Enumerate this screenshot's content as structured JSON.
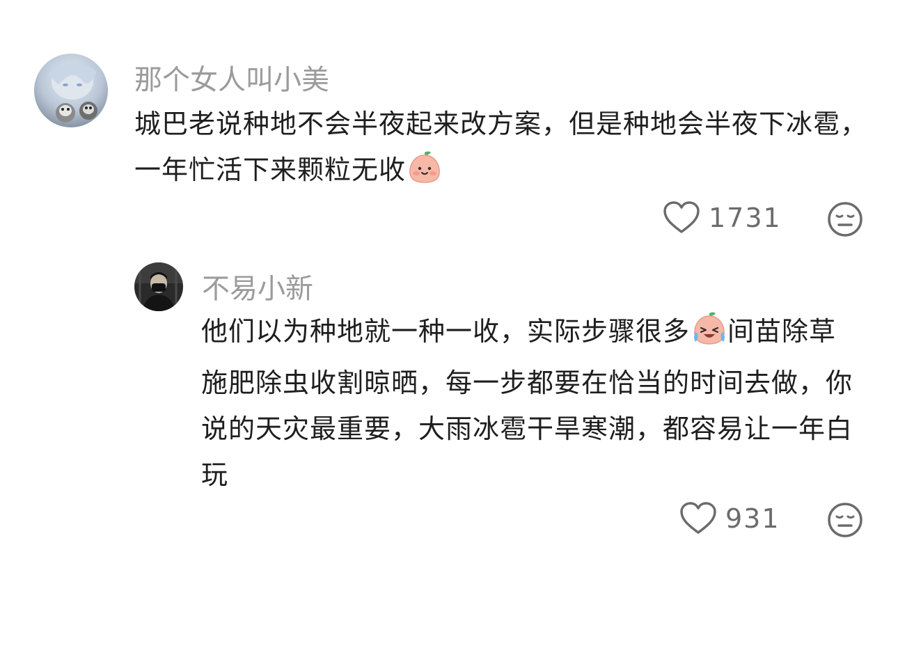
{
  "comments": [
    {
      "username": "那个女人叫小美",
      "text": "城巴老说种地不会半夜起来改方案，但是种地会半夜下冰雹，一年忙活下来颗粒无收",
      "emoji": "peach-smile-emoji",
      "likes": "1731",
      "avatar": "anime-girl-with-cats-avatar"
    },
    {
      "username": "不易小新",
      "text_part1": "他们以为种地就一种一收，实际步骤很多",
      "emoji": "peach-crying-laughing-emoji",
      "text_part2": "间苗除草施肥除虫收割晾晒，每一步都要在恰当的时间去做，你说的天灾最重要，大雨冰雹干旱寒潮，都容易让一年白玩",
      "likes": "931",
      "avatar": "person-with-mask-avatar"
    }
  ],
  "colors": {
    "username": "#9b9b9b",
    "body_text": "#1e1e1e",
    "count_text": "#6b6b6b",
    "icon_stroke": "#6b6b6b",
    "background": "#ffffff"
  }
}
